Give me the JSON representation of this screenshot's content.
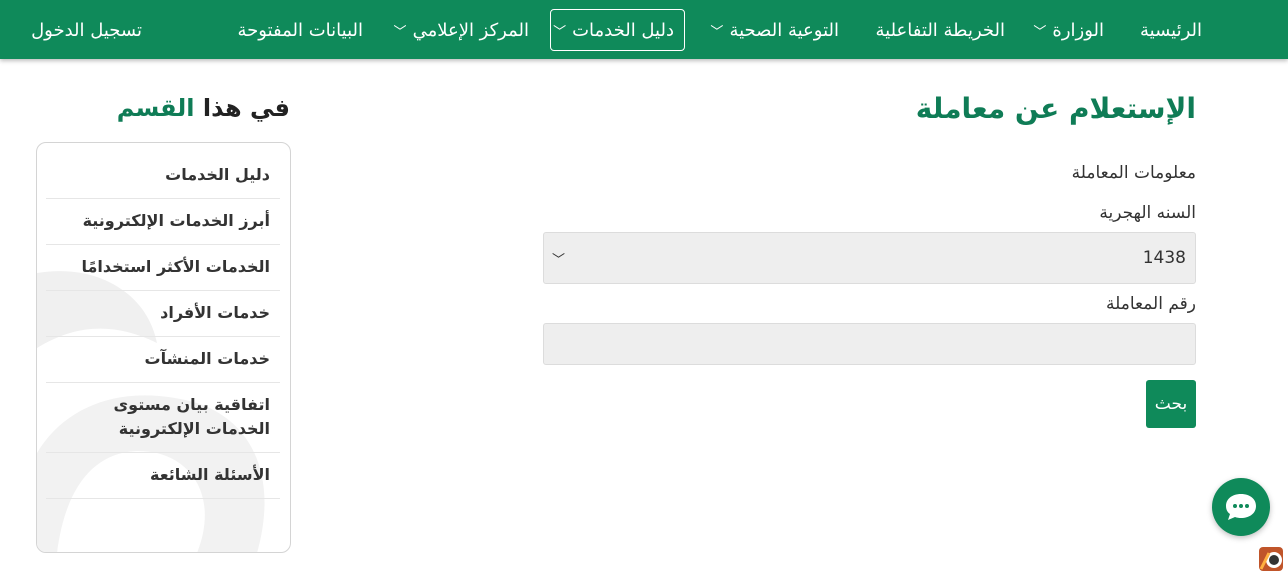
{
  "navbar": {
    "items": [
      {
        "label": "الرئيسية",
        "has_dropdown": false
      },
      {
        "label": "الوزارة",
        "has_dropdown": true
      },
      {
        "label": "الخريطة التفاعلية",
        "has_dropdown": false
      },
      {
        "label": "التوعية الصحية",
        "has_dropdown": true
      },
      {
        "label": "دليل الخدمات",
        "has_dropdown": true,
        "active": true
      },
      {
        "label": "المركز الإعلامي",
        "has_dropdown": true
      },
      {
        "label": "البيانات المفتوحة",
        "has_dropdown": false
      }
    ],
    "login_label": "تسجيل الدخول"
  },
  "main": {
    "title": "الإستعلام عن معاملة",
    "section_label": "معلومات المعاملة",
    "year_label": "السنه الهجرية",
    "year_value": "1438",
    "txn_label": "رقم المعاملة",
    "txn_value": "",
    "search_label": "بحث"
  },
  "sidebar": {
    "title_part1": "في هذا",
    "title_part2": "القسم",
    "items": [
      "دليل الخدمات",
      "أبرز الخدمات الإلكترونية",
      "الخدمات الأكثر استخدامًا",
      "خدمات الأفراد",
      "خدمات المنشآت",
      "اتفاقية بيان مستوى الخدمات الإلكترونية",
      "الأسئلة الشائعة"
    ]
  },
  "colors": {
    "brand_green": "#0f8a5a",
    "title_green": "#0f7c56",
    "input_bg": "#eeeeee"
  },
  "icons": {
    "dropdown": "chevron-down-icon",
    "chat": "chat-bubble-icon",
    "corner": "brand-logo-icon"
  }
}
